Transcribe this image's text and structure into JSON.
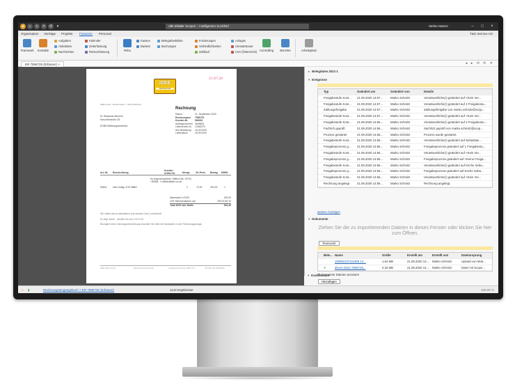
{
  "window": {
    "search_category": "Alle Inhalte",
    "search_text": "Scopen – intelligentes Suchfeld",
    "user": "Stefan Matzer"
  },
  "menu": {
    "tabs": [
      "Organisation",
      "Verträge",
      "Projekte",
      "Finanzen",
      "Personal"
    ],
    "active": "Finanzen",
    "company": "T&G Service AG"
  },
  "ribbon": {
    "big_buttons": [
      "Teamwork",
      "Kontakte",
      "Rebu",
      "Controlling",
      "Berichte",
      "Arbeitsplatz"
    ],
    "small_col1": [
      "Aufgaben",
      "Aktivitäten",
      "Nachrichten"
    ],
    "small_col2": [
      "Kalender",
      "Zeiterfassung",
      "Reiseerfassung"
    ],
    "small_col3": [
      "Kassen",
      "Banken"
    ],
    "small_col4": [
      "Belegarbeitsliste",
      "Buchungen"
    ],
    "small_col5": [
      "Forderungen",
      "Verbindlichkeiten",
      "Zahllauf"
    ],
    "small_col6": [
      "Anlagen",
      "Umsatzsteuer",
      "UVA (Österreich)"
    ]
  },
  "doc_tab": {
    "label": "ER 7596725 (Erfasser)"
  },
  "invoice": {
    "title": "Rechnung",
    "stamp": "21.07.20",
    "logo_text": "IDEE",
    "logo_sub": "Allesinformatik",
    "sender_line": "IDEE GmbH · Musterstraße 1 · 80331 München",
    "address": [
      "Dr. Benjamin Albrecht",
      "Kreuzberstraße 28",
      "",
      "87389 Mittelungsbechlach"
    ],
    "meta": [
      {
        "k": "Datum",
        "v": "21. September 2020"
      },
      {
        "k": "Rechnungsnr.",
        "v": "7596725"
      },
      {
        "k": "Kunden-Nr.",
        "v": "566392"
      },
      {
        "k": "Auftragsnummer",
        "v": "3645833"
      },
      {
        "k": "Lieferschein-Nr.",
        "v": "12649372"
      },
      {
        "k": "Ihre Bestellung",
        "v": "16.09.2020"
      },
      {
        "k": "Lieferdatum",
        "v": "18.09.2020"
      }
    ],
    "columns": [
      "Art.-Nr.",
      "Beschreibung",
      "Kunden Artikel Nr.",
      "Menge",
      "VK-Preis",
      "Betrag",
      "MWSt."
    ],
    "line1": {
      "desc": "Ihr Ansprechpartner: Willich Sat. 19734 / 85398 · 0 willich@idee.co.de"
    },
    "line2": {
      "nr": "90502",
      "desc": "Idee Sofag / IHS 98867",
      "qty": "2",
      "price": "73,00",
      "amount": "290,00",
      "vat": "1"
    },
    "sums": [
      {
        "k": "Warenwert in EUR",
        "v": "290,00"
      },
      {
        "k": "19% Mehrwertsteuer auf",
        "v": "290,00   55,10"
      },
      {
        "k": "Total EUR inkl. MwSt.",
        "v": "302,40"
      }
    ],
    "notes": [
      "Wir haften davon aktualisiert und danach (Voll-) schuldhaft.",
      "Es liegt davon · abolfen bis zum 15.10.20",
      "Bezüglich einer Zahlungsüberweisung beachten Sie bitte die Bankdaten in der Rechnungsanlage."
    ],
    "footer": [
      "IDEE Office GmbH",
      "Deutsche Bank Hamburg",
      "Amtsgericht Hamburg HRB 4771",
      "USt-IdNr. DE 123456789"
    ]
  },
  "panel": {
    "belegdaten_title": "Belegdaten 2021-1",
    "ereignisse_title": "Ereignisse",
    "columns": [
      "Typ",
      "Geändert am",
      "Geändert von",
      "Details"
    ],
    "events": [
      [
        "Freigabestufe Kont...",
        "21.09.2020 14:57...",
        "Marko Schmitz",
        "Verantwortliche(r) geändert auf <Kein Ver..."
      ],
      [
        "Freigabestufe Kont...",
        "21.09.2020 14:57...",
        "Marko Schmitz",
        "Verantwortliche(r) geändert auf 2 Freigabestu..."
      ],
      [
        "Zahlungsfreigabe",
        "21.09.2020 14:57...",
        "Marko Schmitz",
        "Zahlungsfreigabe von marko.schmitz@scop..."
      ],
      [
        "Freigabestufe Kont...",
        "21.09.2020 14:57...",
        "Marko Schmitz",
        "Verantwortliche(r) geändert auf <Kein Ver..."
      ],
      [
        "Freigabestufe Kont...",
        "21.09.2020 14:56...",
        "Marko Schmitz",
        "Verantwortliche(r) geändert auf 2 Freigabestu..."
      ],
      [
        "Fachlich geprüft",
        "21.09.2020 14:56...",
        "Marko Schmitz",
        "Sachlich geprüft von marko.schmitz@scop..."
      ],
      [
        "Prozess gestartet",
        "21.09.2020 14:56...",
        "Marko Schmitz",
        "Prozess wurde gestartet."
      ],
      [
        "Freigabestufe Kont...",
        "21.09.2020 14:56...",
        "Marko Schmitz",
        "Verantwortliche(r) geändert auf Sebastian..."
      ],
      [
        "Freigabeprozess g...",
        "21.09.2020 14:56...",
        "Marko Schmitz",
        "Freigabeprozess geändert auf 1 Freigabestu..."
      ],
      [
        "Freigabestufe Kont...",
        "21.09.2020 14:56...",
        "Marko Schmitz",
        "Verantwortliche(r) geändert auf <Kein Ver..."
      ],
      [
        "Freigabeprozess g...",
        "21.09.2020 14:56...",
        "Marko Schmitz",
        "Freigabeprozess geändert auf <Keine Freiga..."
      ],
      [
        "Freigabestufe Kont...",
        "21.09.2020 14:56...",
        "Marko Schmitz",
        "Verantwortliche(r) geändert auf Küche Seba..."
      ],
      [
        "Freigabeprozess g...",
        "21.09.2020 14:56...",
        "Marko Schmitz",
        "Freigabeprozess geändert auf Küche Seba..."
      ],
      [
        "Freigabestufe Kont...",
        "21.09.2020 14:56...",
        "Marko Schmitz",
        "Verantwortliche(r) geändert auf <Kein Ver..."
      ],
      [
        "Rechnung angelegt",
        "21.09.2020 14:56...",
        "Marko Schmitz",
        "Rechnung angelegt."
      ]
    ],
    "more_link": "weitere Anzeigen",
    "dokumente_title": "Dokumente",
    "dropzone_text": "Ziehen Sie die zu importierenden Dateien in dieses Fenster oder klicken Sie hier zum Öffnen.",
    "teamwork_button": "Teamwork",
    "doc_columns": [
      "Bele...",
      "Name",
      "Größe",
      "Erstellt am",
      "Erstellt von",
      "Dateiursprung"
    ],
    "docs": [
      [
        "",
        "160092107111305 14...",
        "1,64 MB",
        "21.09.2020 14:...",
        "Marko Schmitz",
        "Upload von Mob..."
      ],
      [
        "✔",
        "divere-2021-7596725...",
        "0,32 MB",
        "21.09.2020 14:...",
        "Marko Schmitz",
        "Datei mit Scope..."
      ]
    ],
    "generated_label": "Generierte Dateien anzeigen",
    "kommentare_title": "Kommentare",
    "add_button": "Hinzufügen"
  },
  "status": {
    "breadcrumb": "Rechnungseingangsbuch > ER 7596725 (Erfasser)",
    "results": "1143 Ergebnisse",
    "zoom": "100.00 %"
  },
  "colors": {
    "accent": "#1a64c8",
    "titlebar": "#2d2d2d",
    "viewer_bg": "#505050",
    "highlight": "#fbe8a0"
  }
}
